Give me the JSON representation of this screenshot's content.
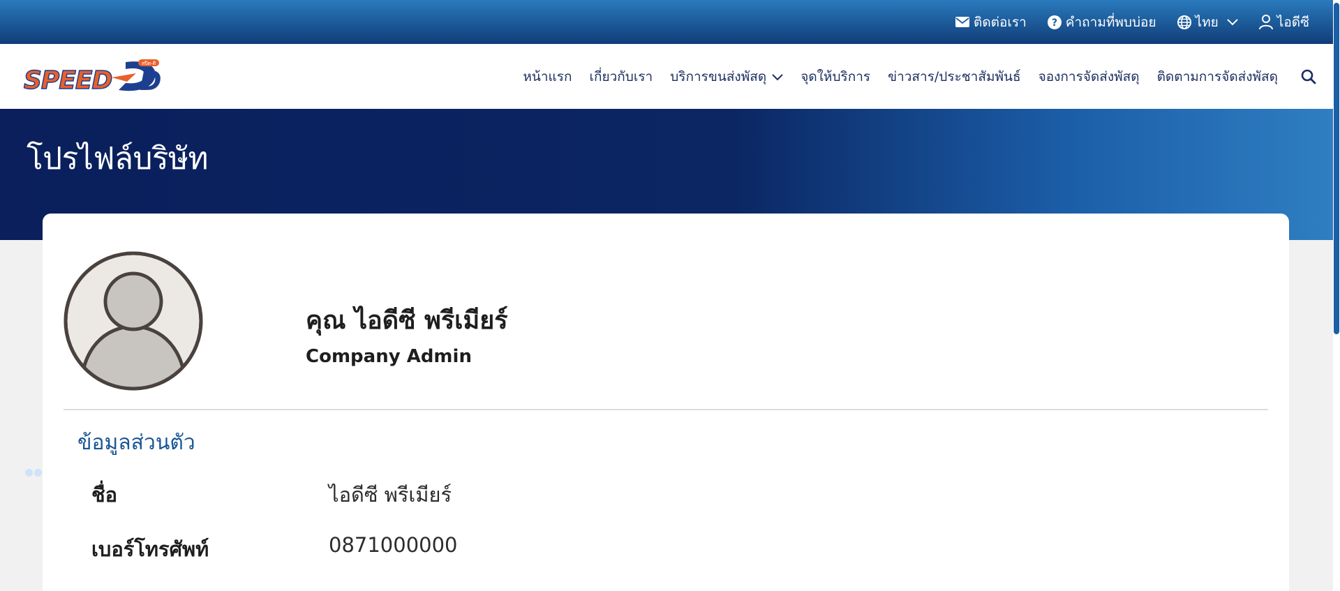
{
  "topbar": {
    "contact_label": "ติดต่อเรา",
    "faq_label": "คำถามที่พบบ่อย",
    "language_label": "ไทย",
    "user_label": "ไอดีซี"
  },
  "brand": {
    "logo_text": "SPEED D",
    "logo_small_text": "สปีด-ดี",
    "colors": {
      "orange": "#e8602a",
      "navy": "#1c3f8f",
      "top_blue": "#1e5e9e",
      "banner": "#0a1f5c",
      "accent": "#1a5596"
    }
  },
  "nav": {
    "items": [
      {
        "label": "หน้าแรก"
      },
      {
        "label": "เกี่ยวกับเรา"
      },
      {
        "label": "บริการขนส่งพัสดุ",
        "has_dropdown": true
      },
      {
        "label": "จุดให้บริการ"
      },
      {
        "label": "ข่าวสาร/ประชาสัมพันธ์"
      },
      {
        "label": "จองการจัดส่งพัสดุ"
      },
      {
        "label": "ติดตามการจัดส่งพัสดุ"
      }
    ]
  },
  "page": {
    "title": "โปรไฟล์บริษัท"
  },
  "profile": {
    "name": "คุณ ไอดีซี พรีเมียร์",
    "role": "Company Admin",
    "section_title": "ข้อมูลส่วนตัว",
    "fields": [
      {
        "label": "ชื่อ",
        "value": "ไอดีซี พรีเมียร์"
      },
      {
        "label": "เบอร์โทรศัพท์",
        "value": "0871000000"
      }
    ]
  },
  "icons": {
    "contact": "envelope-icon",
    "faq": "question-circle-icon",
    "language": "globe-icon",
    "user": "user-icon",
    "dropdown": "chevron-down-icon",
    "search": "search-icon"
  }
}
